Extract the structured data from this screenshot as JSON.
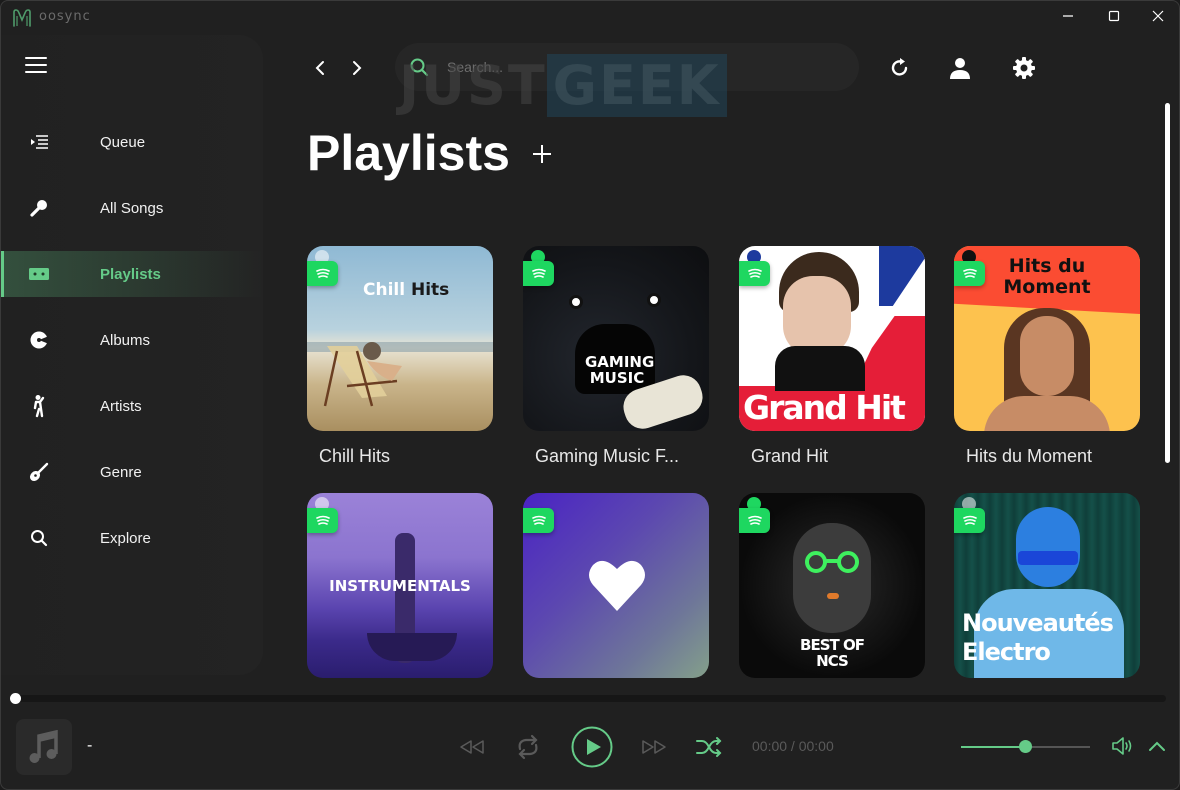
{
  "app": {
    "name": "oosync",
    "accent": "#65cb88",
    "window_controls": {
      "minimize": "minimize-icon",
      "maximize": "maximize-icon",
      "close": "close-icon"
    }
  },
  "sidebar": {
    "menu_icon": "hamburger-icon",
    "items": [
      {
        "label": "Queue",
        "icon": "queue-icon",
        "active": false
      },
      {
        "label": "All Songs",
        "icon": "microphone-icon",
        "active": false
      },
      {
        "label": "Playlists",
        "icon": "cassette-icon",
        "active": true
      },
      {
        "label": "Albums",
        "icon": "disc-icon",
        "active": false
      },
      {
        "label": "Artists",
        "icon": "singer-icon",
        "active": false
      },
      {
        "label": "Genre",
        "icon": "guitar-icon",
        "active": false
      },
      {
        "label": "Explore",
        "icon": "search-icon",
        "active": false
      }
    ]
  },
  "header": {
    "back": "chevron-left-icon",
    "forward": "chevron-right-icon",
    "search_placeholder": "Search...",
    "watermark": {
      "part1": "JUST",
      "part2": "GEEK"
    },
    "actions": [
      "refresh-icon",
      "user-icon",
      "gear-icon"
    ]
  },
  "main": {
    "title": "Playlists",
    "add_label": "+",
    "playlists": [
      {
        "title": "Chill Hits",
        "cover_text_1": "Chill",
        "cover_text_2": "Hits",
        "source": "spotify"
      },
      {
        "title": "Gaming Music F...",
        "cover_text_1": "GAMING",
        "cover_text_2": "MUSIC",
        "source": "spotify"
      },
      {
        "title": "Grand Hit",
        "cover_text_1": "Grand Hit",
        "cover_text_2": "",
        "source": "spotify"
      },
      {
        "title": "Hits du Moment",
        "cover_text_1": "Hits du",
        "cover_text_2": "Moment",
        "source": "spotify"
      },
      {
        "title": "",
        "cover_text_1": "INSTRUMENTALS",
        "cover_text_2": "",
        "source": "spotify"
      },
      {
        "title": "",
        "cover_text_1": "",
        "cover_text_2": "",
        "source": "spotify",
        "icon": "heart-icon"
      },
      {
        "title": "",
        "cover_text_1": "BEST OF",
        "cover_text_2": "NCS",
        "source": "spotify"
      },
      {
        "title": "",
        "cover_text_1": "Nouveautés",
        "cover_text_2": "Electro",
        "source": "spotify"
      }
    ]
  },
  "player": {
    "song_title": "-",
    "time": "00:00 / 00:00",
    "progress_percent": 0,
    "volume_percent": 50,
    "controls": [
      "rewind-icon",
      "repeat-icon",
      "play-icon",
      "fast-forward-icon",
      "shuffle-icon"
    ],
    "volume_icon": "volume-icon",
    "expand_icon": "chevron-up-icon"
  }
}
